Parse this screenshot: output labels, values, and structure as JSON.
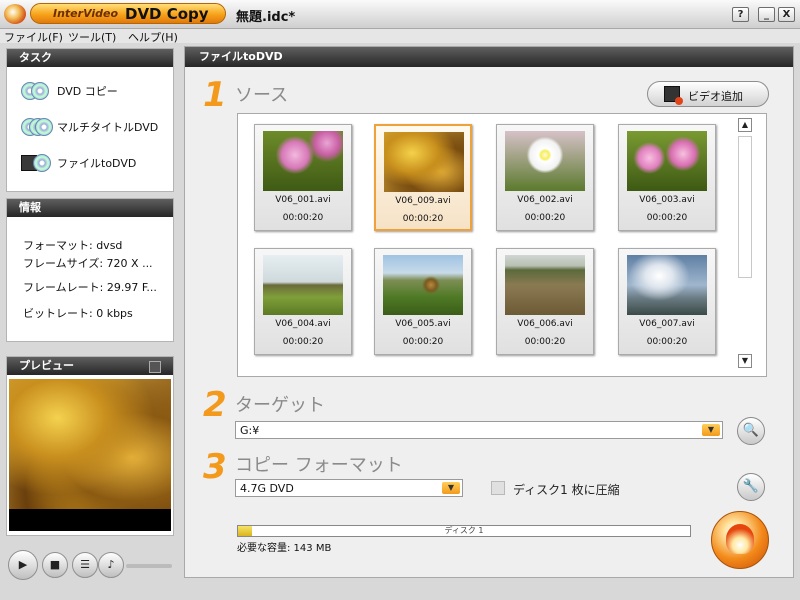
{
  "window": {
    "brand_prefix": "InterVideo",
    "brand_name": "DVD Copy",
    "doc_title": "無題.idc*",
    "help_glyph": "?",
    "minimize_glyph": "_",
    "maximize_glyph": "□",
    "close_glyph": "X"
  },
  "menu": {
    "file": "ファイル(F)",
    "tools": "ツール(T)",
    "help": "ヘルプ(H)"
  },
  "tasks": {
    "header": "タスク",
    "items": [
      {
        "label": "DVD コピー",
        "icon": "dvd-copy-icon"
      },
      {
        "label": "マルチタイトルDVD",
        "icon": "multi-title-icon"
      },
      {
        "label": "ファイルtoDVD",
        "icon": "file-to-dvd-icon"
      }
    ]
  },
  "info": {
    "header": "情報",
    "format": "フォーマット: dvsd",
    "frame_size": "フレームサイズ: 720 X ...",
    "frame_rate": "フレームレート: 29.97 F...",
    "bitrate": "ビットレート: 0 kbps"
  },
  "preview": {
    "header": "プレビュー"
  },
  "main": {
    "header": "ファイルtoDVD",
    "step1_num": "1",
    "step1_title": "ソース",
    "add_video_label": "ビデオ追加",
    "clips": [
      {
        "name": "V06_001.avi",
        "duration": "00:00:20",
        "selected": false
      },
      {
        "name": "V06_009.avi",
        "duration": "00:00:20",
        "selected": true
      },
      {
        "name": "V06_002.avi",
        "duration": "00:00:20",
        "selected": false
      },
      {
        "name": "V06_003.avi",
        "duration": "00:00:20",
        "selected": false
      },
      {
        "name": "V06_004.avi",
        "duration": "00:00:20",
        "selected": false
      },
      {
        "name": "V06_005.avi",
        "duration": "00:00:20",
        "selected": false
      },
      {
        "name": "V06_006.avi",
        "duration": "00:00:20",
        "selected": false
      },
      {
        "name": "V06_007.avi",
        "duration": "00:00:20",
        "selected": false
      }
    ],
    "step2_num": "2",
    "step2_title": "ターゲット",
    "target_value": "G:¥",
    "step3_num": "3",
    "step3_title": "コピー フォーマット",
    "format_value": "4.7G DVD",
    "compress_label": "ディスク1 枚に圧縮",
    "compress_checked": false,
    "capacity_bar_label": "ディスク 1",
    "capacity_fraction": 0.03,
    "required_capacity": "必要な容量: 143 MB"
  },
  "colors": {
    "accent_orange": "#f39a1c",
    "header_dark": "#262626"
  }
}
